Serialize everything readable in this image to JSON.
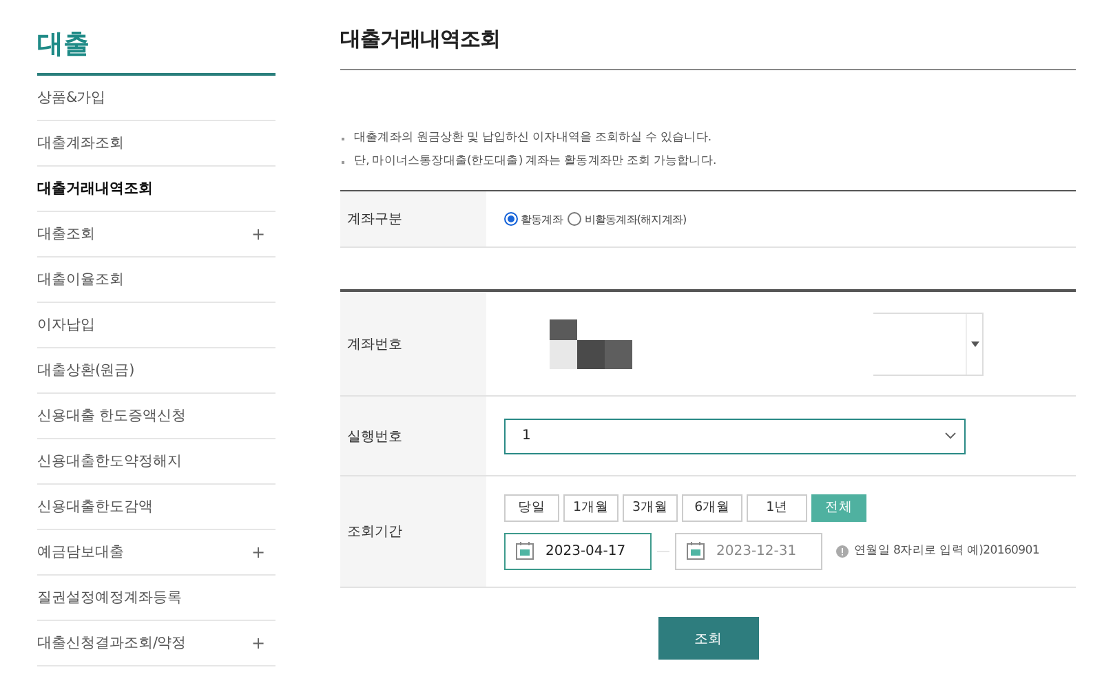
{
  "sidebar": {
    "title": "대출",
    "items": [
      {
        "label": "상품&가입",
        "selected": false
      },
      {
        "label": "대출계좌조회",
        "selected": false
      },
      {
        "label": "대출거래내역조회",
        "selected": true
      },
      {
        "label": "대출조회",
        "selected": false,
        "toggle": "+"
      },
      {
        "label": "대출이율조회",
        "selected": false
      },
      {
        "label": "이자납입",
        "selected": false
      },
      {
        "label": "대출상환(원금)",
        "selected": false
      },
      {
        "label": "신용대출 한도증액신청",
        "selected": false
      },
      {
        "label": "신용대출한도약정해지",
        "selected": false
      },
      {
        "label": "신용대출한도감액",
        "selected": false
      },
      {
        "label": "예금담보대출",
        "selected": false,
        "toggle": "+"
      },
      {
        "label": "질권설정예정계좌등록",
        "selected": false
      },
      {
        "label": "대출신청결과조회/약정",
        "selected": false,
        "toggle": "+"
      }
    ]
  },
  "page_title": "대출거래내역조회",
  "notes": [
    "대출계좌의 원금상환 및 납입하신 이자내역을 조회하실 수 있습니다.",
    "단, 마이너스통장대출(한도대출) 계좌는 활동계좌만 조회 가능합니다."
  ],
  "account_type": {
    "label": "계좌구분",
    "options": [
      {
        "label": "활동계좌",
        "selected": true
      },
      {
        "label": "비활동계좌(해지계좌)",
        "selected": false
      }
    ]
  },
  "account_number": {
    "label": "계좌번호"
  },
  "execution_number": {
    "label": "실행번호",
    "value": "1"
  },
  "period": {
    "label": "조회기간",
    "buttons": [
      {
        "label": "당일",
        "selected": false
      },
      {
        "label": "1개월",
        "selected": false
      },
      {
        "label": "3개월",
        "selected": false
      },
      {
        "label": "6개월",
        "selected": false
      },
      {
        "label": "1년",
        "selected": false
      },
      {
        "label": "전체",
        "selected": true
      }
    ],
    "start_date": {
      "value": "2023-04-17",
      "focused": true
    },
    "end_date": {
      "value": "2023-12-31",
      "focused": false
    },
    "hint": "연월일 8자리로 입력 예)20160901"
  },
  "search_button": "조회"
}
